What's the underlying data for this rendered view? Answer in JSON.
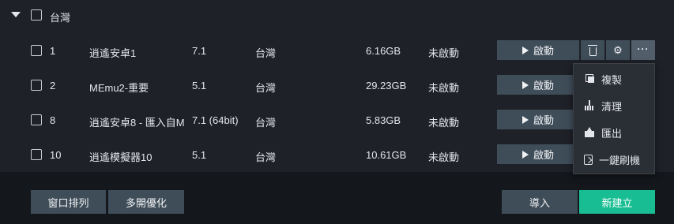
{
  "group": {
    "label": "台灣"
  },
  "instances": [
    {
      "index": "1",
      "name": "逍遙安卓1",
      "version": "7.1",
      "region": "台灣",
      "size": "6.16GB",
      "status": "未啟動"
    },
    {
      "index": "2",
      "name": "MEmu2-重要",
      "version": "5.1",
      "region": "台灣",
      "size": "29.23GB",
      "status": "未啟動"
    },
    {
      "index": "8",
      "name": "逍遙安卓8 - 匯入自M",
      "version": "7.1 (64bit)",
      "region": "台灣",
      "size": "5.83GB",
      "status": "未啟動"
    },
    {
      "index": "10",
      "name": "逍遙模擬器10",
      "version": "5.1",
      "region": "台灣",
      "size": "10.61GB",
      "status": "未啟動"
    }
  ],
  "row_actions": {
    "start_label": "啟動",
    "more_glyph": "···",
    "gear_glyph": "⚙"
  },
  "context_menu": {
    "items": [
      {
        "label": "複製",
        "icon": "copy-icon"
      },
      {
        "label": "清理",
        "icon": "broom-icon"
      },
      {
        "label": "匯出",
        "icon": "export-icon"
      },
      {
        "label": "一鍵刷機",
        "icon": "flash-icon"
      }
    ]
  },
  "footer": {
    "arrange_label": "窗口排列",
    "multi_label": "多開優化",
    "import_label": "導入",
    "new_label": "新建立"
  },
  "colors": {
    "accent": "#19bd93",
    "button": "#3f4d59",
    "panel": "#1e2127",
    "footer": "#14171b"
  }
}
